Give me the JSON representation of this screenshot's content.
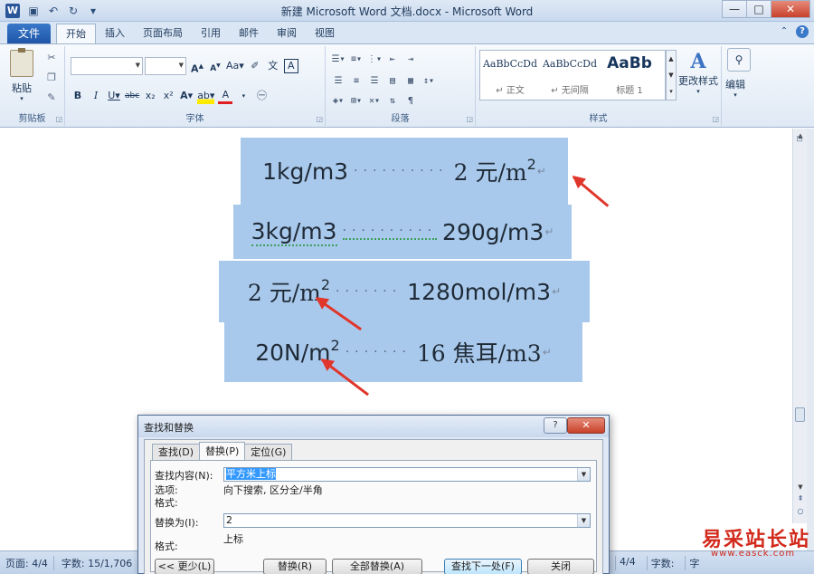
{
  "window": {
    "title": "新建 Microsoft Word 文档.docx  -  Microsoft Word",
    "minimize": "—",
    "maximize": "□",
    "close": "✕"
  },
  "ribbon_tabs": {
    "file": "文件",
    "tabs": [
      "开始",
      "插入",
      "页面布局",
      "引用",
      "邮件",
      "审阅",
      "视图"
    ],
    "active_index": 0
  },
  "ribbon": {
    "clipboard": {
      "paste_label": "粘贴",
      "group_label": "剪贴板"
    },
    "font": {
      "font_name": "",
      "font_size": "",
      "group_label": "字体"
    },
    "paragraph": {
      "group_label": "段落"
    },
    "styles": {
      "items": [
        {
          "sample": "AaBbCcDd",
          "name": "↵ 正文"
        },
        {
          "sample": "AaBbCcDd",
          "name": "↵ 无间隔"
        },
        {
          "sample": "AaBb",
          "name": "标题 1"
        }
      ],
      "change_styles_label": "更改样式",
      "group_label": "样式"
    },
    "editing": {
      "label": "编辑"
    }
  },
  "document": {
    "lines": [
      {
        "left": "1kg/m3",
        "right_prefix": "2 元/m",
        "right_suffix": ""
      },
      {
        "left": "3kg/m3",
        "right_prefix": "290g/m3",
        "right_suffix": ""
      },
      {
        "left": "2 元/m",
        "right_prefix": "1280mol/m3",
        "right_suffix": ""
      },
      {
        "left": "20N/m",
        "right_prefix": "16 焦耳/m3",
        "right_suffix": ""
      }
    ],
    "superscript": "2",
    "paragraph_mark": "↵",
    "dots": "··········",
    "dots_short": "·······"
  },
  "dialog": {
    "title": "查找和替换",
    "help_btn": "?",
    "close_btn": "✕",
    "tabs": [
      "查找(D)",
      "替换(P)",
      "定位(G)"
    ],
    "active_tab": 1,
    "find_label": "查找内容(N):",
    "find_value": "平方米上标",
    "options_label": "选项:",
    "options_value": "向下搜索, 区分全/半角",
    "format_label": "格式:",
    "replace_label": "替换为(I):",
    "replace_value": "2",
    "replace_format_label": "格式:",
    "replace_format_value": "上标",
    "buttons": {
      "less": "<< 更少(L)",
      "replace": "替换(R)",
      "replace_all": "全部替换(A)",
      "find_next": "查找下一处(F)",
      "close": "关闭"
    }
  },
  "statusbar": {
    "page": "页面: 4/4",
    "words": "字数: 15/1,706",
    "right_page": "4/4",
    "right_words": "字数:",
    "right_extra": "字"
  },
  "watermark": {
    "text": "易采站长站",
    "url": "www.easck.com"
  }
}
